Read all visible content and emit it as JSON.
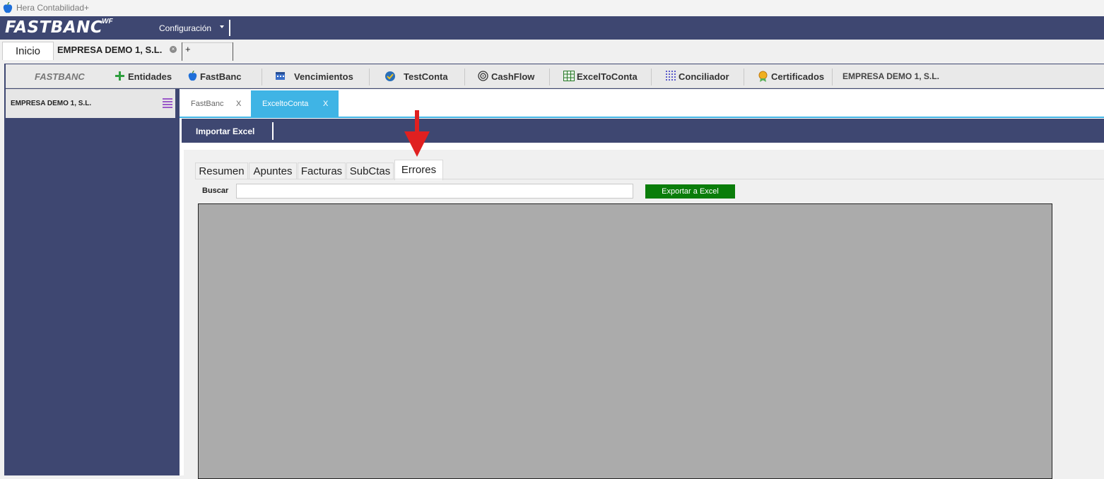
{
  "window": {
    "title": "Hera Contabilidad+"
  },
  "topbar": {
    "brand": "FASTBANC",
    "brand_sup": "WF",
    "config_label": "Configuración"
  },
  "doc_tabs": {
    "inicio": "Inicio",
    "empresa": "EMPRESA DEMO 1, S.L.",
    "close": "×",
    "add": "+"
  },
  "toolbar": {
    "brand": "FASTBANC",
    "items": [
      "Entidades",
      "FastBanc",
      "Vencimientos",
      "TestConta",
      "CashFlow",
      "ExcelToConta",
      "Conciliador",
      "Certificados"
    ],
    "company": "EMPRESA DEMO 1, S.L."
  },
  "sidebar": {
    "company": "EMPRESA DEMO 1, S.L."
  },
  "module_tabs": [
    {
      "label": "FastBanc",
      "close": "X"
    },
    {
      "label": "ExceltoConta",
      "close": "X"
    }
  ],
  "importbar": {
    "label": "Importar Excel"
  },
  "inner_tabs": [
    "Resumen",
    "Apuntes",
    "Facturas",
    "SubCtas",
    "Errores"
  ],
  "active_inner_tab": "Errores",
  "search": {
    "label": "Buscar",
    "value": ""
  },
  "export_button": "Exportar a Excel",
  "colors": {
    "navy": "#3e4771",
    "accent_blue": "#3fb4e5",
    "export_green": "#0a7d0a",
    "arrow_red": "#e02020"
  }
}
